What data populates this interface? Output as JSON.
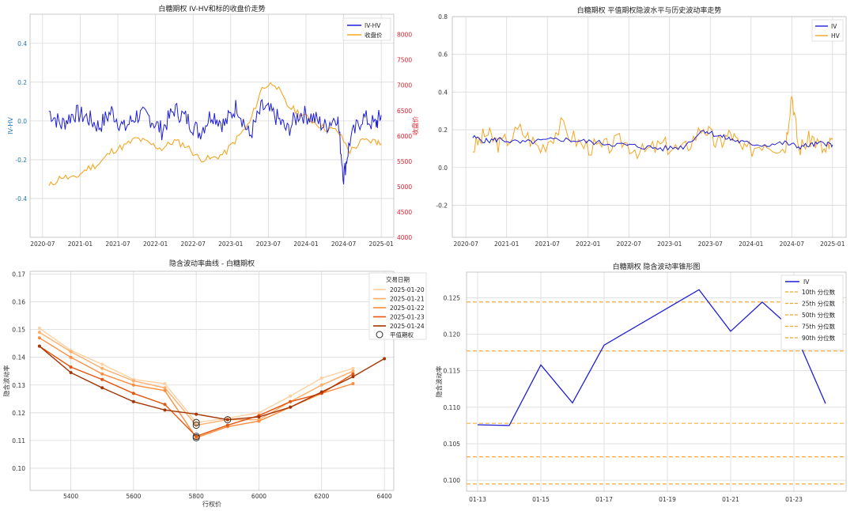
{
  "chart_data": [
    {
      "type": "line",
      "title": "白糖期权 IV-HV和标的收盘价走势",
      "ylabel": "IV-HV",
      "y2label": "收盘价",
      "ylim": [
        -0.6,
        0.55
      ],
      "y2lim": [
        4000,
        8400
      ],
      "yticks": [
        -0.4,
        -0.2,
        0.0,
        0.2,
        0.4
      ],
      "y2ticks": [
        4000,
        4500,
        5000,
        5500,
        6000,
        6500,
        7000,
        7500,
        8000
      ],
      "xticks": [
        "2020-07",
        "2021-01",
        "2021-07",
        "2022-01",
        "2022-07",
        "2023-01",
        "2023-07",
        "2024-01",
        "2024-07",
        "2025-01"
      ],
      "colors": {
        "iv_hv": "#1f1fd6",
        "close": "#f5a623",
        "y2axis": "#e0202a",
        "yaxis": "#1f77b4"
      },
      "series": [
        {
          "name": "IV-HV",
          "axis": "left",
          "x": [
            "2020-08",
            "2020-10",
            "2020-12",
            "2021-02",
            "2021-04",
            "2021-06",
            "2021-08",
            "2021-10",
            "2021-12",
            "2022-02",
            "2022-04",
            "2022-06",
            "2022-08",
            "2022-10",
            "2022-12",
            "2023-02",
            "2023-04",
            "2023-06",
            "2023-08",
            "2023-10",
            "2023-12",
            "2024-02",
            "2024-04",
            "2024-06",
            "2024-07",
            "2024-08",
            "2024-10",
            "2024-12",
            "2025-01"
          ],
          "values": [
            0.05,
            -0.02,
            0.04,
            0.02,
            -0.03,
            0.05,
            -0.04,
            0.03,
            0.02,
            -0.05,
            0.06,
            0.01,
            -0.06,
            0.04,
            -0.02,
            0.08,
            -0.08,
            0.07,
            0.03,
            -0.05,
            0.04,
            0.02,
            -0.03,
            0.03,
            -0.29,
            -0.1,
            0.02,
            -0.02,
            0.03
          ]
        },
        {
          "name": "收盘价",
          "axis": "right",
          "x": [
            "2020-08",
            "2020-10",
            "2020-12",
            "2021-02",
            "2021-04",
            "2021-06",
            "2021-08",
            "2021-10",
            "2021-12",
            "2022-02",
            "2022-04",
            "2022-06",
            "2022-08",
            "2022-10",
            "2022-12",
            "2023-02",
            "2023-04",
            "2023-06",
            "2023-08",
            "2023-10",
            "2023-12",
            "2024-02",
            "2024-04",
            "2024-06",
            "2024-08",
            "2024-10",
            "2024-12",
            "2025-01"
          ],
          "values": [
            5000,
            5200,
            5150,
            5350,
            5450,
            5700,
            5800,
            5950,
            5850,
            5750,
            5900,
            5800,
            5550,
            5550,
            5650,
            5950,
            6250,
            6950,
            7050,
            6600,
            6450,
            6300,
            6150,
            6100,
            5700,
            5900,
            5900,
            5850
          ]
        }
      ],
      "legend": "top-right"
    },
    {
      "type": "line",
      "title": "白糖期权 平值期权隐波水平与历史波动率走势",
      "ylim": [
        -0.37,
        0.8
      ],
      "yticks": [
        -0.2,
        0.0,
        0.2,
        0.4,
        0.6,
        0.8
      ],
      "xticks": [
        "2020-07",
        "2021-01",
        "2021-07",
        "2022-01",
        "2022-07",
        "2023-01",
        "2023-07",
        "2024-01",
        "2024-07",
        "2025-01"
      ],
      "colors": {
        "IV": "#1f1fd6",
        "HV": "#f5a623"
      },
      "series": [
        {
          "name": "IV",
          "x": [
            "2020-08",
            "2020-10",
            "2020-12",
            "2021-03",
            "2021-06",
            "2021-09",
            "2021-12",
            "2022-03",
            "2022-06",
            "2022-09",
            "2022-12",
            "2023-03",
            "2023-06",
            "2023-08",
            "2023-10",
            "2023-12",
            "2024-03",
            "2024-06",
            "2024-08",
            "2024-10",
            "2024-12",
            "2025-01"
          ],
          "values": [
            0.16,
            0.14,
            0.15,
            0.13,
            0.14,
            0.15,
            0.14,
            0.13,
            0.12,
            0.11,
            0.1,
            0.11,
            0.2,
            0.17,
            0.15,
            0.13,
            0.12,
            0.13,
            0.11,
            0.12,
            0.13,
            0.12
          ]
        },
        {
          "name": "HV",
          "x": [
            "2020-08",
            "2020-10",
            "2020-12",
            "2021-03",
            "2021-06",
            "2021-09",
            "2021-12",
            "2022-03",
            "2022-06",
            "2022-09",
            "2022-12",
            "2023-03",
            "2023-06",
            "2023-08",
            "2023-10",
            "2023-12",
            "2024-03",
            "2024-06",
            "2024-07",
            "2024-08",
            "2024-10",
            "2024-12",
            "2025-01"
          ],
          "values": [
            0.1,
            0.18,
            0.12,
            0.2,
            0.1,
            0.22,
            0.12,
            0.1,
            0.14,
            0.08,
            0.12,
            0.09,
            0.22,
            0.12,
            0.18,
            0.08,
            0.14,
            0.1,
            0.4,
            0.1,
            0.16,
            0.08,
            0.15
          ]
        }
      ],
      "legend": "top-right"
    },
    {
      "type": "line",
      "title": "隐含波动率曲线 - 白糖期权",
      "xlabel": "行权价",
      "ylabel": "隐含波动率",
      "xlim": [
        5270,
        6430
      ],
      "ylim": [
        0.092,
        0.171
      ],
      "xticks": [
        5400,
        5600,
        5800,
        6000,
        6200,
        6400
      ],
      "yticks": [
        0.1,
        0.11,
        0.12,
        0.13,
        0.14,
        0.15,
        0.16,
        0.17
      ],
      "legend_title": "交易日期",
      "legend": "top-right",
      "atm_label": "平值期权",
      "categories": [
        5300,
        5400,
        5500,
        5600,
        5700,
        5800,
        5900,
        6000,
        6100,
        6200,
        6300,
        6400
      ],
      "series": [
        {
          "name": "2025-01-20",
          "color": "#fdd0a2",
          "strikes": [
            5300,
            5400,
            5500,
            5600,
            5700,
            5800,
            5900,
            6000,
            6100,
            6200,
            6300
          ],
          "values": [
            0.1505,
            0.1425,
            0.1375,
            0.132,
            0.1305,
            0.1165,
            0.118,
            0.12,
            0.126,
            0.1325,
            0.136
          ]
        },
        {
          "name": "2025-01-21",
          "color": "#fdae6b",
          "strikes": [
            5300,
            5400,
            5500,
            5600,
            5700,
            5800,
            5900,
            6000,
            6100,
            6200,
            6300
          ],
          "values": [
            0.149,
            0.142,
            0.136,
            0.1315,
            0.129,
            0.1155,
            0.1175,
            0.1175,
            0.124,
            0.13,
            0.135
          ]
        },
        {
          "name": "2025-01-22",
          "color": "#fd8d3c",
          "strikes": [
            5300,
            5400,
            5500,
            5600,
            5700,
            5800,
            5900,
            6000,
            6100,
            6200,
            6300
          ],
          "values": [
            0.147,
            0.14,
            0.134,
            0.13,
            0.128,
            0.111,
            0.115,
            0.117,
            0.122,
            0.127,
            0.1305
          ]
        },
        {
          "name": "2025-01-23",
          "color": "#e6550d",
          "strikes": [
            5300,
            5400,
            5500,
            5600,
            5700,
            5800,
            5900,
            6000,
            6100,
            6200,
            6300
          ],
          "values": [
            0.144,
            0.1365,
            0.132,
            0.127,
            0.123,
            0.1115,
            0.1155,
            0.119,
            0.124,
            0.127,
            0.134
          ]
        },
        {
          "name": "2025-01-24",
          "color": "#a63603",
          "strikes": [
            5300,
            5400,
            5500,
            5600,
            5700,
            5800,
            5900,
            6000,
            6100,
            6200,
            6300,
            6400
          ],
          "values": [
            0.144,
            0.1345,
            0.129,
            0.124,
            0.121,
            0.1195,
            0.1175,
            0.1185,
            0.122,
            0.1275,
            0.133,
            0.1395
          ]
        }
      ],
      "atm_points": [
        {
          "x": 5800,
          "y": 0.1165
        },
        {
          "x": 5800,
          "y": 0.1155
        },
        {
          "x": 5800,
          "y": 0.111
        },
        {
          "x": 5800,
          "y": 0.1115
        },
        {
          "x": 5900,
          "y": 0.1175
        }
      ]
    },
    {
      "type": "line",
      "title": "白糖期权 隐含波动率锥形图",
      "ylabel": "隐含波动率",
      "ylim": [
        0.0985,
        0.1285
      ],
      "yticks": [
        0.1,
        0.105,
        0.11,
        0.115,
        0.12,
        0.125
      ],
      "x": [
        "01-13",
        "01-14",
        "01-15",
        "01-16",
        "01-17",
        "01-18",
        "01-19",
        "01-20",
        "01-21",
        "01-22",
        "01-23",
        "01-24"
      ],
      "xticks": [
        "01-13",
        "01-15",
        "01-17",
        "01-19",
        "01-21",
        "01-23"
      ],
      "series": [
        {
          "name": "IV",
          "color": "#1f1fd6",
          "values": [
            0.1076,
            0.1075,
            0.1158,
            0.1106,
            0.1185,
            null,
            null,
            0.1261,
            0.1204,
            0.1244,
            0.1205,
            0.1105
          ]
        }
      ],
      "percentiles": [
        {
          "name": "10th 分位数",
          "value": 0.0995
        },
        {
          "name": "25th 分位数",
          "value": 0.1032
        },
        {
          "name": "50th 分位数",
          "value": 0.1078
        },
        {
          "name": "75th 分位数",
          "value": 0.1177
        },
        {
          "name": "90th 分位数",
          "value": 0.1244
        }
      ],
      "percentile_color": "#f5a623",
      "legend": "top-right"
    }
  ]
}
